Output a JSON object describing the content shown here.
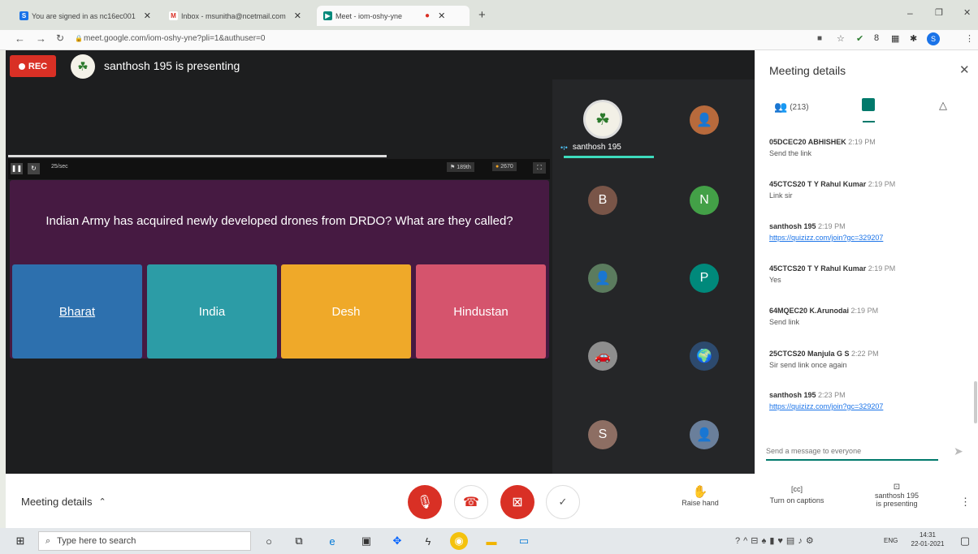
{
  "tabs": [
    {
      "label": "You are signed in as nc16ec001",
      "icon": "s-favicon",
      "color": "#1a73e8"
    },
    {
      "label": "Inbox - msunitha@ncetmail.com",
      "icon": "gmail-favicon",
      "color": "#d93025"
    },
    {
      "label": "Meet - iom-oshy-yne",
      "icon": "meet-favicon",
      "color": "#00897b"
    }
  ],
  "address": {
    "url": "meet.google.com/iom-oshy-yne?pli=1&authuser=0"
  },
  "recording": {
    "label": "REC"
  },
  "presenter": {
    "text": "santhosh 195 is presenting"
  },
  "quiz": {
    "timer": "25/sec",
    "rank": "189th",
    "score": "2670",
    "question": "Indian Army has acquired newly developed drones from DRDO? What are they called?",
    "options": [
      {
        "label": "Bharat",
        "color": "#2d70ae"
      },
      {
        "label": "India",
        "color": "#2c9ca6"
      },
      {
        "label": "Desh",
        "color": "#efa929"
      },
      {
        "label": "Hindustan",
        "color": "#d5546d"
      }
    ]
  },
  "participants": {
    "presenter_label": "santhosh 195",
    "tiles": [
      {
        "initial": "",
        "color": "#f2f0e6",
        "icon": "logo-avatar"
      },
      {
        "initial": "",
        "color": "#b86a3c",
        "icon": "photo-avatar"
      },
      {
        "initial": "B",
        "color": "#795548"
      },
      {
        "initial": "N",
        "color": "#43a047"
      },
      {
        "initial": "",
        "color": "#5b7b5e",
        "icon": "photo-avatar"
      },
      {
        "initial": "P",
        "color": "#00897b"
      },
      {
        "initial": "",
        "color": "#8e8e8e",
        "icon": "photo-avatar"
      },
      {
        "initial": "",
        "color": "#2d4a6e",
        "icon": "photo-avatar"
      },
      {
        "initial": "S",
        "color": "#8d6e63"
      },
      {
        "initial": "",
        "color": "#6a7f9b",
        "icon": "photo-avatar"
      }
    ]
  },
  "panel": {
    "title": "Meeting details",
    "people_count": "(213)",
    "input_placeholder": "Send a message to everyone",
    "messages": [
      {
        "name": "05DCEC20 ABHISHEK",
        "time": "2:19 PM",
        "text": "Send the link",
        "link": ""
      },
      {
        "name": "45CTCS20 T Y Rahul Kumar",
        "time": "2:19 PM",
        "text": "Link sir",
        "link": ""
      },
      {
        "name": "santhosh 195",
        "time": "2:19 PM",
        "text": "",
        "link": "https://quizizz.com/join?gc=329207"
      },
      {
        "name": "45CTCS20 T Y Rahul Kumar",
        "time": "2:19 PM",
        "text": "Yes",
        "link": ""
      },
      {
        "name": "64MQEC20 K.Arunodai",
        "time": "2:19 PM",
        "text": "Send link",
        "link": ""
      },
      {
        "name": "25CTCS20 Manjula G S",
        "time": "2:22 PM",
        "text": "Sir send link once again",
        "link": ""
      },
      {
        "name": "santhosh 195",
        "time": "2:23 PM",
        "text": "",
        "link": "https://quizizz.com/join?gc=329207"
      }
    ]
  },
  "bottom": {
    "meeting_details": "Meeting details",
    "raise_hand": "Raise hand",
    "captions": "Turn on captions",
    "presenting_line1": "santhosh 195",
    "presenting_line2": "is presenting"
  },
  "taskbar": {
    "search": "Type here to search",
    "lang": "ENG",
    "time": "14:31",
    "date": "22-01-2021"
  }
}
